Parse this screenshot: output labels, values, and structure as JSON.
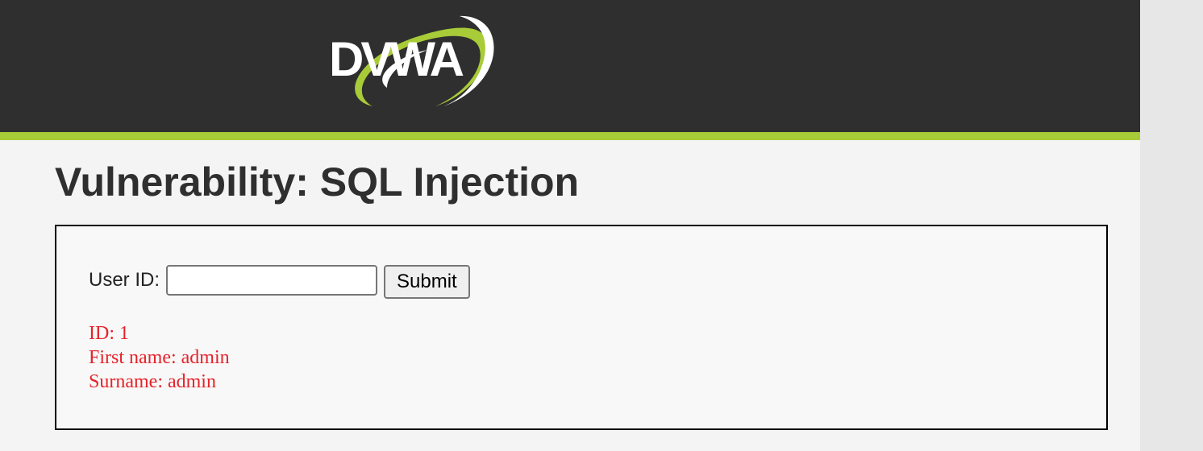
{
  "header": {
    "logo_text": "DVWA"
  },
  "main": {
    "title": "Vulnerability: SQL Injection",
    "form": {
      "user_id_label": "User ID:",
      "user_id_value": "",
      "submit_label": "Submit"
    },
    "result": {
      "id_line": "ID: 1",
      "first_name_line": "First name: admin",
      "surname_line": "Surname: admin"
    }
  },
  "colors": {
    "header_bg": "#2f2f2f",
    "accent_green": "#a8cb38",
    "result_red": "#e8212a",
    "page_bg": "#f4f4f4"
  }
}
